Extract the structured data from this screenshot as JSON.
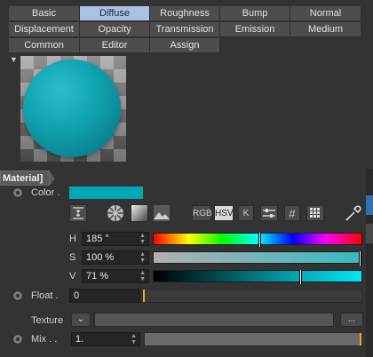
{
  "tabs": {
    "row1": [
      "Basic",
      "Diffuse",
      "Roughness",
      "Bump",
      "Normal"
    ],
    "row2": [
      "Displacement",
      "Opacity",
      "Transmission",
      "Emission",
      "Medium"
    ],
    "row3": [
      "Common",
      "Editor",
      "Assign"
    ],
    "active": "Diffuse"
  },
  "material_tag": "Material]",
  "color": {
    "label": "Color .",
    "swatch": "#00a9b5",
    "mode_buttons": [
      "RGB",
      "HSV",
      "K",
      "#"
    ],
    "active_mode": "HSV",
    "h": {
      "label": "H",
      "value": "185 °",
      "fraction": 0.514
    },
    "s": {
      "label": "S",
      "value": "100 %",
      "fraction": 1.0
    },
    "v": {
      "label": "V",
      "value": "71 %",
      "fraction": 0.71
    }
  },
  "float": {
    "label": "Float .",
    "value": "0"
  },
  "texture": {
    "label": "Texture",
    "browse": "..."
  },
  "mix": {
    "label": "Mix . .",
    "value": "1.",
    "fraction": 1.0
  },
  "colors": {
    "accent": "#00a9b5",
    "active_tab": "#a9c1e3",
    "marker": "#f5a623"
  }
}
